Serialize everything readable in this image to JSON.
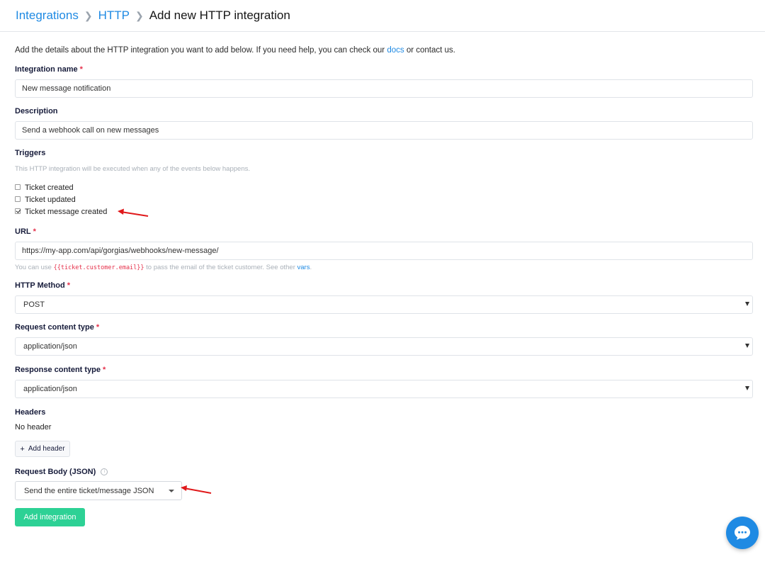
{
  "breadcrumb": {
    "root": "Integrations",
    "parent": "HTTP",
    "current": "Add new HTTP integration"
  },
  "intro": {
    "prefix": "Add the details about the HTTP integration you want to add below. If you need help, you can check our",
    "docs_link": "docs",
    "suffix": "or contact us."
  },
  "integration_name": {
    "label": "Integration name",
    "required": "*",
    "value": "New message notification"
  },
  "description": {
    "label": "Description",
    "value": "Send a webhook call on new messages"
  },
  "triggers": {
    "label": "Triggers",
    "hint": "This HTTP integration will be executed when any of the events below happens.",
    "options": [
      {
        "label": "Ticket created",
        "checked": false
      },
      {
        "label": "Ticket updated",
        "checked": false
      },
      {
        "label": "Ticket message created",
        "checked": true
      }
    ]
  },
  "url": {
    "label": "URL",
    "required": "*",
    "value": "https://my-app.com/api/gorgias/webhooks/new-message/",
    "hint_prefix": "You can use",
    "hint_code": "{{ticket.customer.email}}",
    "hint_middle": "to pass the email of the ticket customer. See other",
    "hint_link": "vars",
    "hint_end": "."
  },
  "http_method": {
    "label": "HTTP Method",
    "required": "*",
    "value": "POST"
  },
  "request_content_type": {
    "label": "Request content type",
    "required": "*",
    "value": "application/json"
  },
  "response_content_type": {
    "label": "Response content type",
    "required": "*",
    "value": "application/json"
  },
  "headers": {
    "label": "Headers",
    "empty_text": "No header",
    "add_button": "Add header",
    "add_icon": "+"
  },
  "request_body": {
    "label": "Request Body (JSON)",
    "info_icon": "i",
    "value": "Send the entire ticket/message JSON"
  },
  "submit": {
    "label": "Add integration"
  },
  "colors": {
    "accent": "#1f8ae3",
    "success": "#2dd195",
    "required": "#e5304a",
    "annotation": "#e0191b"
  }
}
